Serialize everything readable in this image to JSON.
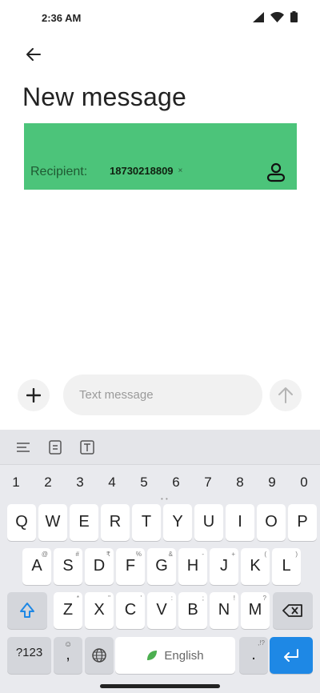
{
  "status_bar": {
    "time": "2:36 AM"
  },
  "header": {
    "title": "New message"
  },
  "recipient": {
    "label": "Recipient:",
    "chip_text": "18730218809",
    "chip_remove": "×"
  },
  "compose": {
    "placeholder": "Text message"
  },
  "keyboard": {
    "numbers": [
      "1",
      "2",
      "3",
      "4",
      "5",
      "6",
      "7",
      "8",
      "9",
      "0"
    ],
    "row1": [
      "Q",
      "W",
      "E",
      "R",
      "T",
      "Y",
      "U",
      "I",
      "O",
      "P"
    ],
    "row2": [
      {
        "k": "A",
        "h": "@"
      },
      {
        "k": "S",
        "h": "#"
      },
      {
        "k": "D",
        "h": "₹"
      },
      {
        "k": "F",
        "h": "%"
      },
      {
        "k": "G",
        "h": "&"
      },
      {
        "k": "H",
        "h": "-"
      },
      {
        "k": "J",
        "h": "+"
      },
      {
        "k": "K",
        "h": "("
      },
      {
        "k": "L",
        "h": ")"
      }
    ],
    "row3": [
      {
        "k": "Z",
        "h": "*"
      },
      {
        "k": "X",
        "h": "\""
      },
      {
        "k": "C",
        "h": "'"
      },
      {
        "k": "V",
        "h": ":"
      },
      {
        "k": "B",
        "h": ";"
      },
      {
        "k": "N",
        "h": "!"
      },
      {
        "k": "M",
        "h": "?"
      }
    ],
    "symbols_label": "?123",
    "comma_label": ",",
    "space_label": "English",
    "period_label": ".",
    "period_hint": ",!?"
  },
  "colors": {
    "recipient_bg": "#4cc47a",
    "enter_key": "#1e88e5",
    "keyboard_bg": "#e9eaee"
  },
  "icons": [
    "signal-icon",
    "wifi-icon",
    "battery-icon",
    "back-arrow-icon",
    "contact-icon",
    "plus-icon",
    "send-arrow-icon",
    "list-icon",
    "clipboard-icon",
    "text-box-icon",
    "shift-icon",
    "backspace-icon",
    "emoji-icon",
    "globe-icon",
    "leaf-icon",
    "enter-icon"
  ]
}
